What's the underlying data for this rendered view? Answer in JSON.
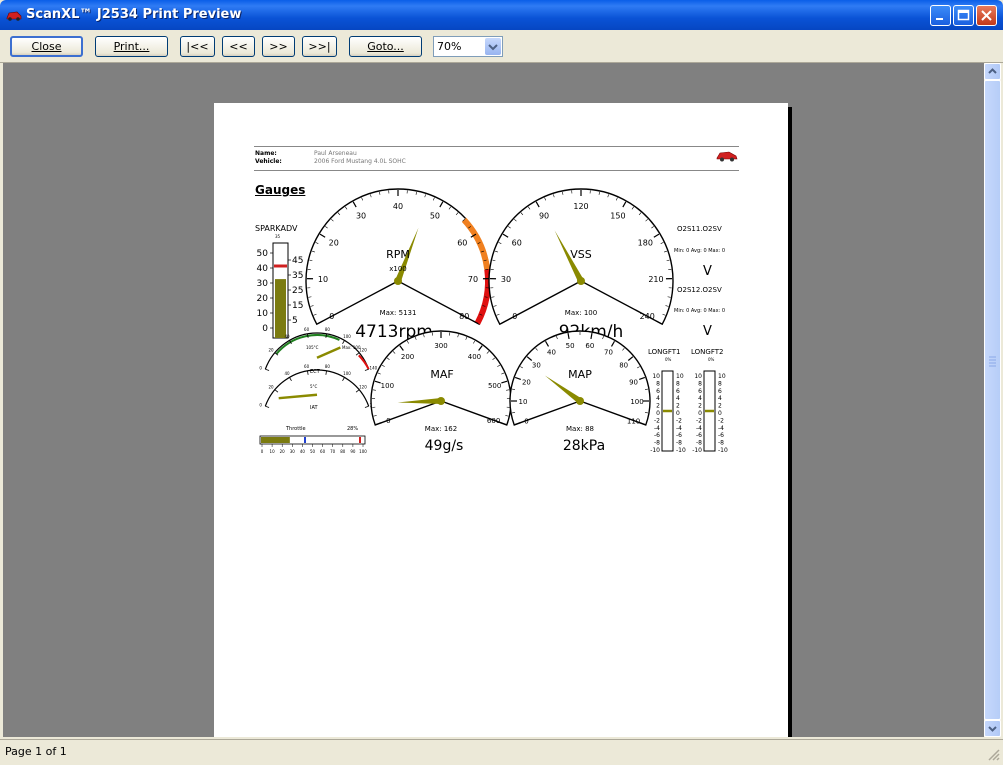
{
  "window": {
    "title": "ScanXL™ J2534 Print Preview"
  },
  "toolbar": {
    "close": "Close",
    "print": "Print...",
    "first": "|<<",
    "prev": "<<",
    "next": ">>",
    "last": ">>|",
    "goto": "Goto...",
    "zoom": "70%"
  },
  "status": {
    "page": "Page 1 of 1"
  },
  "report": {
    "name_label": "Name:",
    "name_value": "Paul Arseneau",
    "vehicle_label": "Vehicle:",
    "vehicle_value": "2006 Ford Mustang 4.0L SOHC",
    "section_title": "Gauges"
  },
  "gauges": {
    "spark": {
      "label": "SPARKADV",
      "small": "35",
      "left_ticks": [
        "50",
        "40",
        "30",
        "20",
        "10",
        "0"
      ],
      "right_ticks": [
        "45",
        "35",
        "25",
        "15",
        "5"
      ],
      "level": 0.62
    },
    "rpm": {
      "label": "RPM",
      "multiplier": "x100",
      "ticks": [
        "0",
        "10",
        "20",
        "30",
        "40",
        "50",
        "60",
        "70",
        "80"
      ],
      "max": "Max: 5131",
      "readout": "4713rpm",
      "value": 47.13
    },
    "vss": {
      "label": "VSS",
      "ticks": [
        "0",
        "30",
        "60",
        "90",
        "120",
        "150",
        "180",
        "210",
        "240"
      ],
      "max": "Max: 100",
      "readout": "92km/h",
      "value": 92
    },
    "maf": {
      "label": "MAF",
      "ticks": [
        "0",
        "100",
        "200",
        "300",
        "400",
        "500",
        "600"
      ],
      "max": "Max: 162",
      "readout": "49g/s",
      "value": 49
    },
    "map": {
      "label": "MAP",
      "ticks": [
        "0",
        "10",
        "20",
        "30",
        "40",
        "50",
        "60",
        "70",
        "80",
        "90",
        "100",
        "110"
      ],
      "max": "Max: 88",
      "readout": "28kPa",
      "value": 28
    },
    "o2s11": {
      "label": "O2S11.O2SV",
      "stats": "Min: 0  Avg: 0  Max: 0",
      "unit": "V"
    },
    "o2s12": {
      "label": "O2S12.O2SV",
      "stats": "Min: 0  Avg: 0  Max: 0",
      "unit": "V"
    },
    "longft1": {
      "label": "LONGFT1",
      "pct": "0%",
      "ticks": [
        "10",
        "8",
        "6",
        "4",
        "2",
        "0",
        "-2",
        "-4",
        "-6",
        "-8",
        "-10"
      ]
    },
    "longft2": {
      "label": "LONGFT2",
      "pct": "0%",
      "ticks": [
        "10",
        "8",
        "6",
        "4",
        "2",
        "0",
        "-2",
        "-4",
        "-6",
        "-8",
        "-10"
      ]
    },
    "ect": {
      "label": "ECT",
      "top": "105°C",
      "max": "Max: 100",
      "mid": "5°C",
      "ticks": [
        "0",
        "20",
        "40",
        "60",
        "80",
        "100",
        "120",
        "140"
      ]
    },
    "iat": {
      "label": "IAT",
      "ticks": [
        "0",
        "20",
        "40",
        "60",
        "80",
        "100",
        "120",
        "140"
      ]
    },
    "throttle": {
      "label": "Throttle",
      "pct": "28%",
      "ticks": [
        "0",
        "10",
        "20",
        "30",
        "40",
        "50",
        "60",
        "70",
        "80",
        "90",
        "100"
      ],
      "value": 28
    }
  },
  "colors": {
    "needle": "#8a8a00",
    "redzone": "#e01010",
    "orange": "#f08020",
    "titlebar": "#0a5ee8"
  }
}
